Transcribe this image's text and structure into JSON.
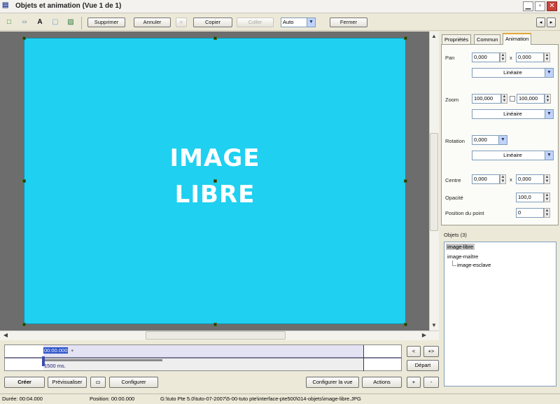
{
  "window": {
    "title": "Objets et animation  (Vue 1 de 1)"
  },
  "toolbar": {
    "icons": [
      "rectangle-tool-icon",
      "button-tool-icon",
      "text-tool-icon",
      "frame-tool-icon",
      "image-tool-icon"
    ],
    "text_tool_glyph": "A",
    "delete_label": "Supprimer",
    "cancel_label": "Annuler",
    "forward_label": ">",
    "copy_label": "Copier",
    "paste_label": "Coller",
    "zoom_value": "Auto",
    "close_label": "Fermer",
    "nav_left": "◂",
    "nav_right": "▸"
  },
  "canvas": {
    "image_text": "IMAGE\nLIBRE",
    "background_color": "#1fd0f0"
  },
  "tabs": [
    {
      "label": "Propriétés",
      "active": false
    },
    {
      "label": "Commun",
      "active": false
    },
    {
      "label": "Animation",
      "active": true
    }
  ],
  "animation": {
    "pan_label": "Pan",
    "pan_x": "0,000",
    "pan_y": "0,000",
    "pan_sep": "x",
    "pan_mode": "Linéaire",
    "zoom_label": "Zoom",
    "zoom_x": "100,000",
    "zoom_y": "100,000",
    "zoom_mode": "Linéaire",
    "rotation_label": "Rotation",
    "rotation_value": "0,000",
    "rotation_mode": "Linéaire",
    "center_label": "Centre",
    "center_x": "0,000",
    "center_y": "0,000",
    "center_sep": "x",
    "opacity_label": "Opacité",
    "opacity_value": "100,0",
    "point_label": "Position du point",
    "point_value": "0"
  },
  "objects": {
    "title": "Objets (3)",
    "items": [
      "image-libre",
      "image-maître",
      "image-esclave"
    ]
  },
  "timeline": {
    "time": "00:00.000",
    "time_suffix": "+",
    "duration": "1500 ms."
  },
  "timeline_controls": {
    "prev": "<",
    "next": "+>",
    "start": "Départ",
    "plus": "+",
    "minus": "-"
  },
  "bottom": {
    "create": "Créer",
    "preview": "Prévisualiser",
    "configure": "Configurer",
    "configure_view": "Configurer la vue",
    "actions": "Actions"
  },
  "status": {
    "duration": "Durée:  00:04.000",
    "position": "Position:  00:00.000",
    "path": "G:\\tuto Pte 5.0\\tuto-07-2007\\5-00-tuto pte\\interface-pte500\\014-objets\\image-libre.JPG"
  }
}
